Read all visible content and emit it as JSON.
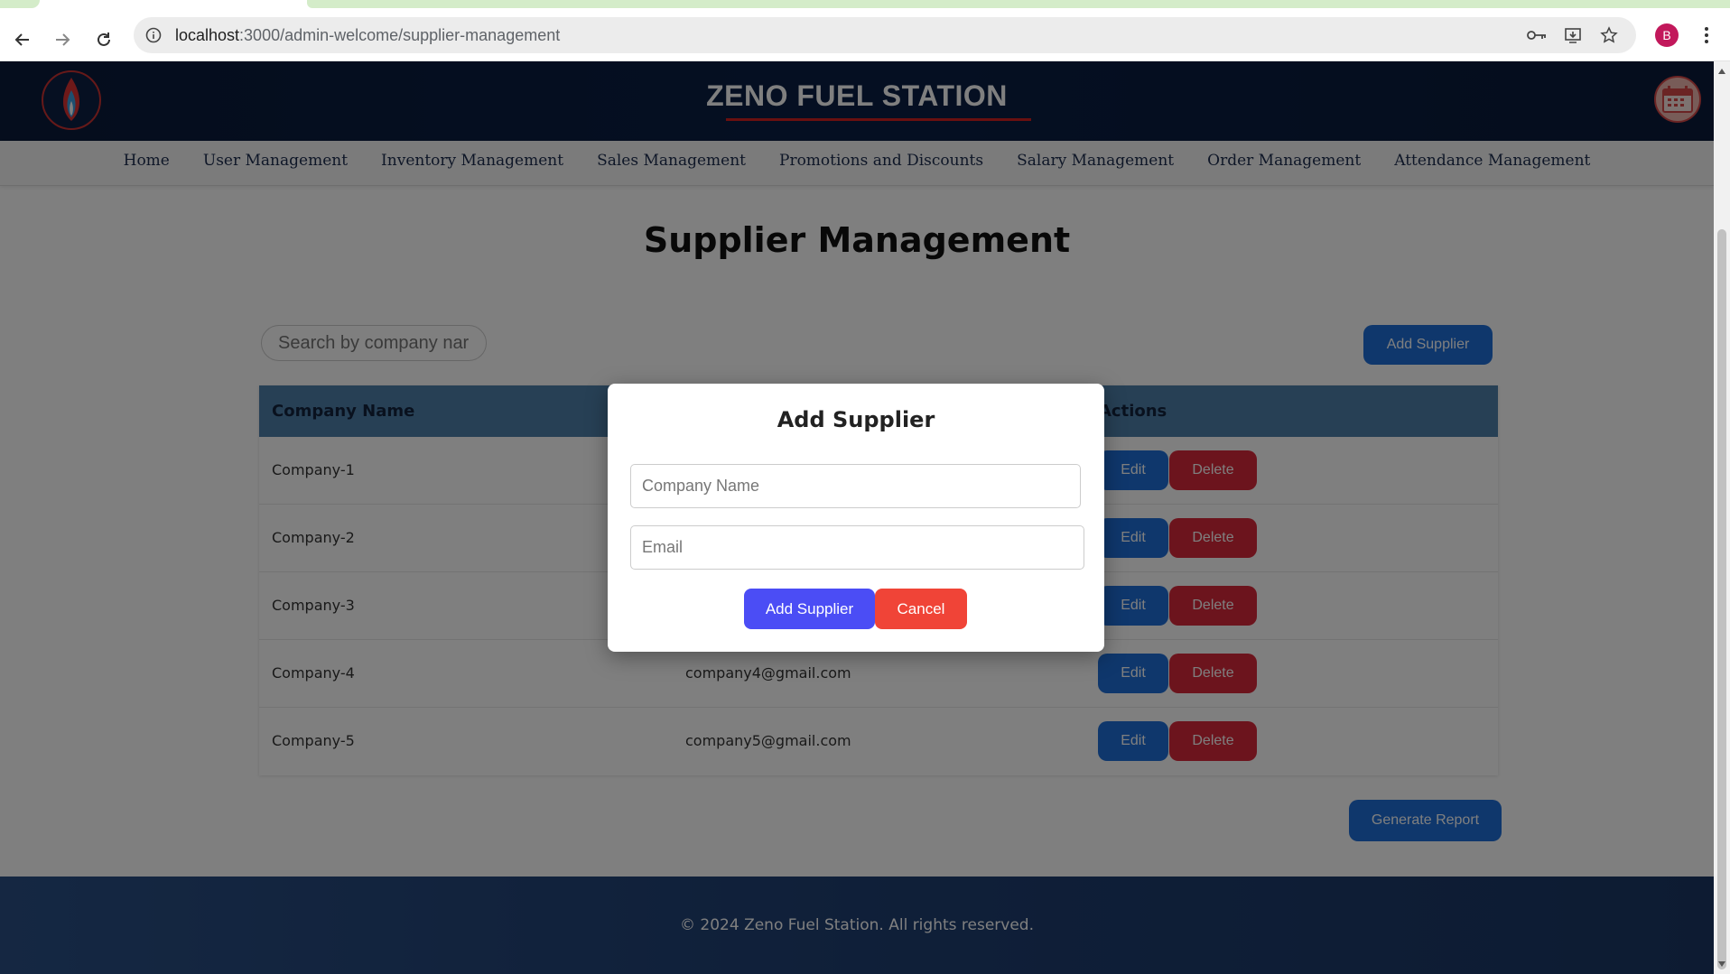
{
  "browser": {
    "url_host": "localhost",
    "url_path": ":3000/admin-welcome/supplier-management",
    "profile_initial": "B"
  },
  "header": {
    "site_title": "ZENO FUEL STATION",
    "logo_icon": "flame-logo-icon",
    "avatar_icon": "calendar-icon"
  },
  "nav": {
    "items": [
      "Home",
      "User Management",
      "Inventory Management",
      "Sales Management",
      "Promotions and Discounts",
      "Salary Management",
      "Order Management",
      "Attendance Management"
    ]
  },
  "page": {
    "title": "Supplier Management",
    "search_placeholder": "Search by company nar",
    "add_button": "Add Supplier",
    "report_button": "Generate Report"
  },
  "table": {
    "columns": [
      "Company Name",
      "Actions"
    ],
    "rows": [
      {
        "company": "Company-1",
        "email": "",
        "edit": "Edit",
        "delete": "Delete"
      },
      {
        "company": "Company-2",
        "email": "",
        "edit": "Edit",
        "delete": "Delete"
      },
      {
        "company": "Company-3",
        "email": "",
        "edit": "Edit",
        "delete": "Delete"
      },
      {
        "company": "Company-4",
        "email": "company4@gmail.com",
        "edit": "Edit",
        "delete": "Delete"
      },
      {
        "company": "Company-5",
        "email": "company5@gmail.com",
        "edit": "Edit",
        "delete": "Delete"
      }
    ]
  },
  "modal": {
    "title": "Add Supplier",
    "company_placeholder": "Company Name",
    "email_placeholder": "Email",
    "submit": "Add Supplier",
    "cancel": "Cancel"
  },
  "footer": {
    "text": "© 2024 Zeno Fuel Station. All rights reserved."
  },
  "colors": {
    "primary": "#1f6fd9",
    "danger": "#d9293a",
    "modal_submit": "#4b4df5",
    "modal_cancel": "#f04437",
    "header_bg": "#0b1f45"
  }
}
